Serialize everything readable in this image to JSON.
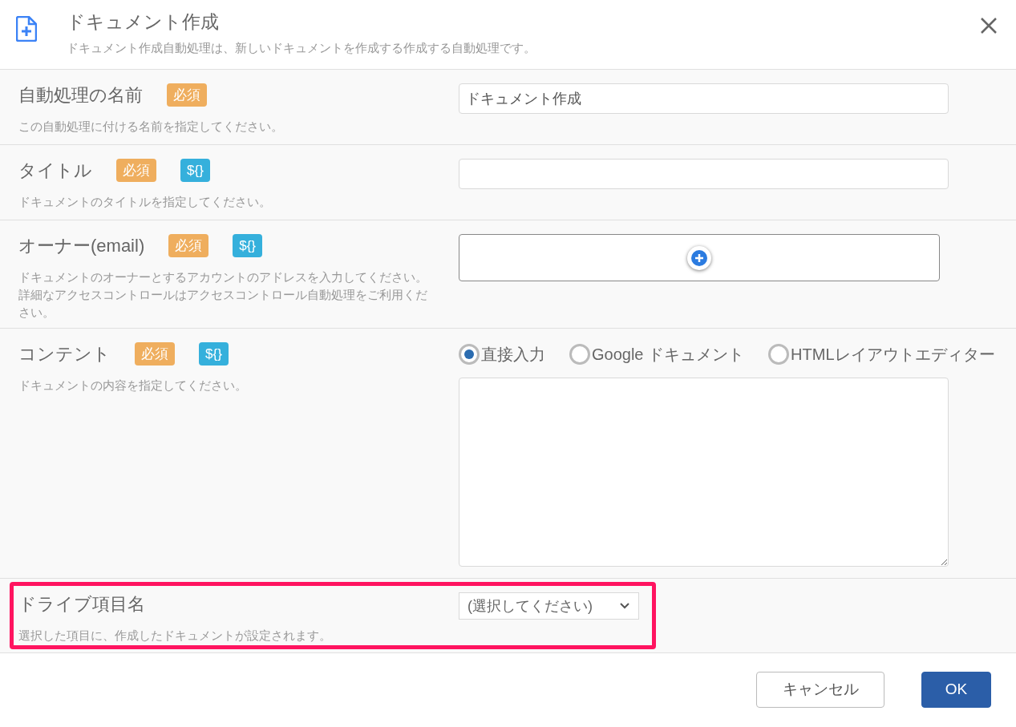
{
  "dialog": {
    "title": "ドキュメント作成",
    "subtitle": "ドキュメント作成自動処理は、新しいドキュメントを作成する作成する自動処理です。"
  },
  "fields": [
    {
      "kind": "text",
      "label": "自動処理の名前",
      "badges": [
        {
          "kind": "required",
          "text": "必須"
        }
      ],
      "help": "この自動処理に付ける名前を指定してください。",
      "value": "ドキュメント作成",
      "highlighted": false
    },
    {
      "kind": "text",
      "label": "タイトル",
      "badges": [
        {
          "kind": "required",
          "text": "必須"
        },
        {
          "kind": "variable",
          "text": "${}"
        }
      ],
      "help": "ドキュメントのタイトルを指定してください。",
      "highlighted": false
    },
    {
      "kind": "list",
      "label": "オーナー(email)",
      "badges": [
        {
          "kind": "required",
          "text": "必須"
        },
        {
          "kind": "variable",
          "text": "${}"
        }
      ],
      "help": "ドキュメントのオーナーとするアカウントのアドレスを入力してください。詳細なアクセスコントロールはアクセスコントロール自動処理をご利用ください。",
      "highlighted": false
    },
    {
      "kind": "content",
      "label": "コンテント",
      "badges": [
        {
          "kind": "required",
          "text": "必須"
        },
        {
          "kind": "variable",
          "text": "${}"
        }
      ],
      "help": "ドキュメントの内容を指定してください。",
      "options": [
        {
          "label": "直接入力",
          "selected": true
        },
        {
          "label": "Google ドキュメント",
          "selected": false
        },
        {
          "label": "HTMLレイアウトエディター",
          "selected": false
        }
      ],
      "highlighted": false
    },
    {
      "kind": "select",
      "label": "ドライブ項目名",
      "help": "選択した項目に、作成したドキュメントが設定されます。",
      "value": "(選択してください)",
      "highlighted": true
    }
  ],
  "buttons": [
    {
      "kind": "secondary",
      "label": "キャンセル"
    },
    {
      "kind": "primary",
      "label": "OK"
    }
  ]
}
